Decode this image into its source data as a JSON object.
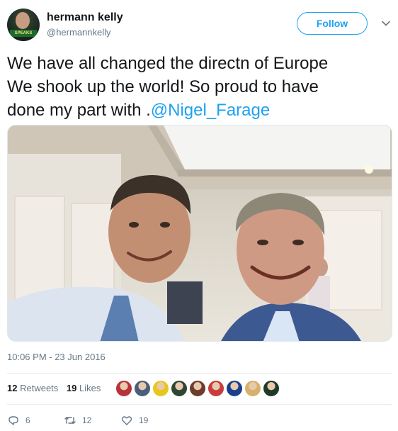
{
  "author": {
    "display_name": "hermann kelly",
    "screen_name": "@hermannkelly",
    "avatar_banner_text": "SPEAKS"
  },
  "follow_label": "Follow",
  "tweet": {
    "text_line1": "We have all changed the directn of Europe",
    "text_line2": "We shook up the world! So proud  to have",
    "text_line3_prefix": "done my part with .",
    "mention": "@Nigel_Farage"
  },
  "photo": {
    "description_icon": "photo-image"
  },
  "timestamp": "10:06 PM - 23 Jun 2016",
  "stats": {
    "retweets_count": "12",
    "retweets_label": "Retweets",
    "likes_count": "19",
    "likes_label": "Likes"
  },
  "liker_avatars": [
    "#b8323b",
    "#4a5d7a",
    "#e8c61c",
    "#2e4633",
    "#6b3d2a",
    "#c73d3d",
    "#1b3f8a",
    "#d7b16c",
    "#1f3a2a"
  ],
  "actions": {
    "reply_count": "6",
    "retweet_count": "12",
    "like_count": "19"
  },
  "colors": {
    "accent": "#1da1f2",
    "text": "#14171a",
    "muted": "#657786"
  }
}
